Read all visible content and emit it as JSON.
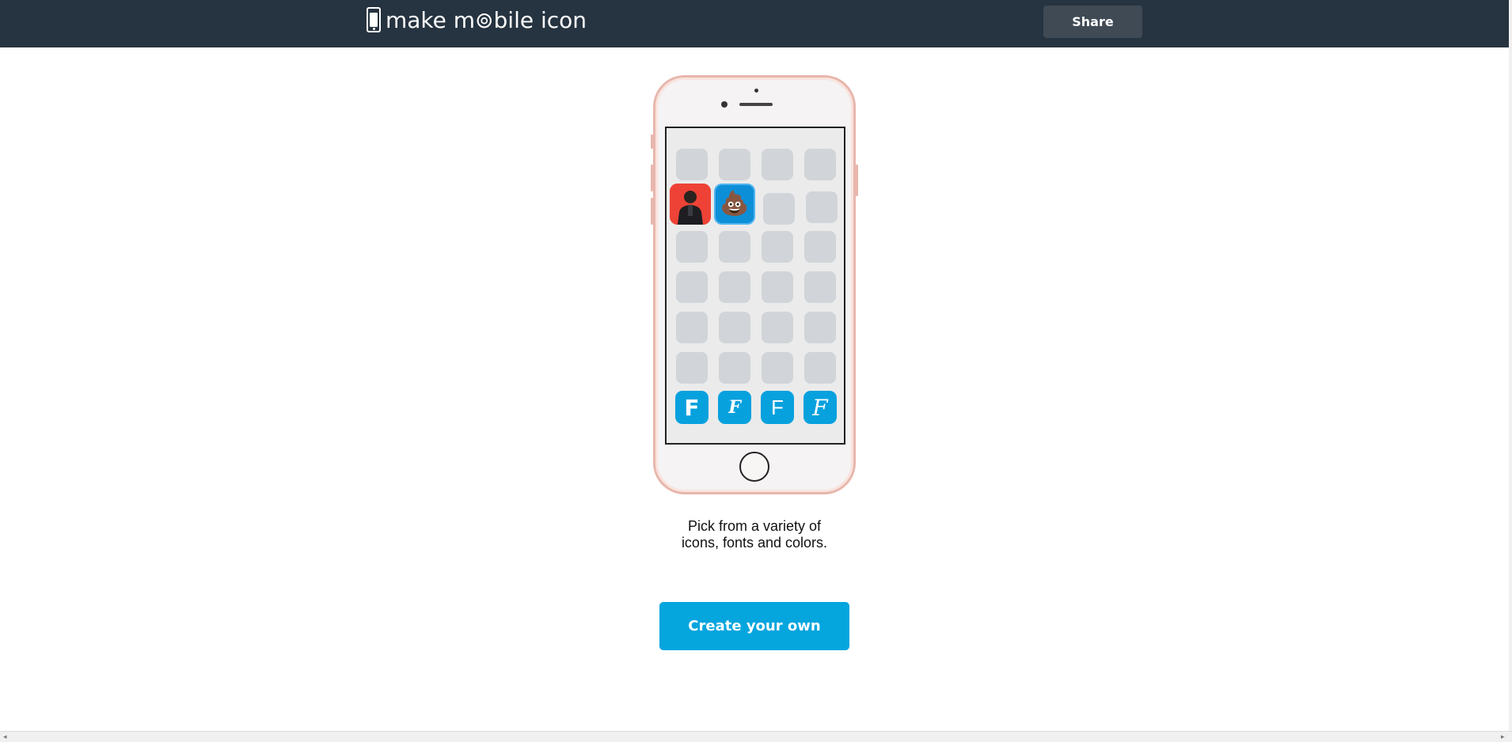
{
  "header": {
    "logo_text": "make m⊚bile icon",
    "share_label": "Share"
  },
  "phone": {
    "grid_rows": 7,
    "grid_cols": 4,
    "featured": [
      {
        "type": "photo",
        "color": "#ee4236",
        "icon": "person-photo-icon"
      },
      {
        "type": "emoji",
        "color": "#0d8fd8",
        "glyph": "💩"
      }
    ],
    "dock_letters": [
      "F",
      "F",
      "F",
      "F"
    ],
    "accent": "#07a1de"
  },
  "caption": {
    "line1": "Pick from a variety of",
    "line2": "icons, fonts and colors."
  },
  "cta": {
    "label": "Create your own",
    "color": "#05a5de"
  },
  "scrollbar": {
    "left_arrow": "◂",
    "right_arrow": "▸"
  }
}
